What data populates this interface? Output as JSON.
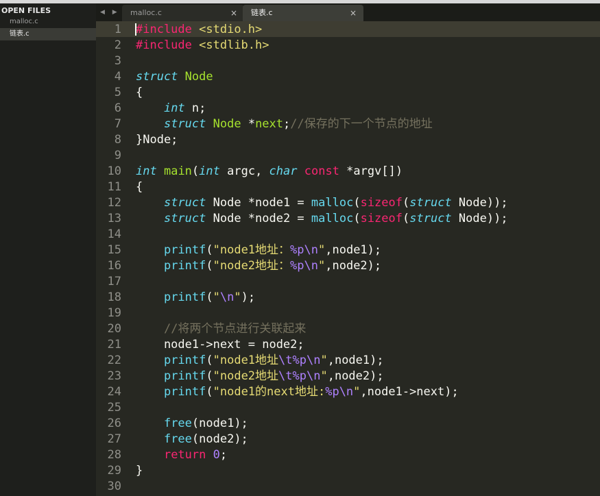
{
  "sidebar": {
    "header": "OPEN FILES",
    "items": [
      {
        "label": "malloc.c",
        "active": false
      },
      {
        "label": "链表.c",
        "active": true
      }
    ]
  },
  "tabs": {
    "nav_arrows": "◀ ▶",
    "items": [
      {
        "label": "malloc.c",
        "close": "×",
        "active": false
      },
      {
        "label": "链表.c",
        "close": "×",
        "active": true
      }
    ]
  },
  "editor": {
    "line_numbers": [
      "1",
      "2",
      "3",
      "4",
      "5",
      "6",
      "7",
      "8",
      "9",
      "10",
      "11",
      "12",
      "13",
      "14",
      "15",
      "16",
      "17",
      "18",
      "19",
      "20",
      "21",
      "22",
      "23",
      "24",
      "25",
      "26",
      "27",
      "28",
      "29",
      "30"
    ],
    "lines": [
      [
        [
          "pre",
          "#include"
        ],
        [
          "",
          " "
        ],
        [
          "str",
          "<stdio.h>"
        ]
      ],
      [
        [
          "pre",
          "#include"
        ],
        [
          "",
          " "
        ],
        [
          "str",
          "<stdlib.h>"
        ]
      ],
      [],
      [
        [
          "type",
          "struct"
        ],
        [
          "",
          " "
        ],
        [
          "cls",
          "Node"
        ]
      ],
      [
        [
          "",
          "{"
        ]
      ],
      [
        [
          "",
          "    "
        ],
        [
          "type",
          "int"
        ],
        [
          "",
          " n;"
        ]
      ],
      [
        [
          "",
          "    "
        ],
        [
          "type",
          "struct"
        ],
        [
          "",
          " "
        ],
        [
          "cls",
          "Node"
        ],
        [
          "",
          " *"
        ],
        [
          "cls",
          "next"
        ],
        [
          "",
          ";"
        ],
        [
          "cmt",
          "//保存的下一个节点的地址"
        ]
      ],
      [
        [
          "",
          "}Node;"
        ]
      ],
      [],
      [
        [
          "type",
          "int"
        ],
        [
          "",
          " "
        ],
        [
          "fn",
          "main"
        ],
        [
          "",
          "("
        ],
        [
          "type",
          "int"
        ],
        [
          "",
          " argc, "
        ],
        [
          "type",
          "char"
        ],
        [
          "",
          " "
        ],
        [
          "kw",
          "const"
        ],
        [
          "",
          " *argv[])"
        ]
      ],
      [
        [
          "",
          "{"
        ]
      ],
      [
        [
          "",
          "    "
        ],
        [
          "type",
          "struct"
        ],
        [
          "",
          " Node *node1 = "
        ],
        [
          "call",
          "malloc"
        ],
        [
          "",
          "("
        ],
        [
          "kw",
          "sizeof"
        ],
        [
          "",
          "("
        ],
        [
          "type",
          "struct"
        ],
        [
          "",
          " Node));"
        ]
      ],
      [
        [
          "",
          "    "
        ],
        [
          "type",
          "struct"
        ],
        [
          "",
          " Node *node2 = "
        ],
        [
          "call",
          "malloc"
        ],
        [
          "",
          "("
        ],
        [
          "kw",
          "sizeof"
        ],
        [
          "",
          "("
        ],
        [
          "type",
          "struct"
        ],
        [
          "",
          " Node));"
        ]
      ],
      [],
      [
        [
          "",
          "    "
        ],
        [
          "call",
          "printf"
        ],
        [
          "",
          "("
        ],
        [
          "str",
          "\"node1地址："
        ],
        [
          "esc",
          "%p\\n"
        ],
        [
          "str",
          "\""
        ],
        [
          "",
          ",node1);"
        ]
      ],
      [
        [
          "",
          "    "
        ],
        [
          "call",
          "printf"
        ],
        [
          "",
          "("
        ],
        [
          "str",
          "\"node2地址："
        ],
        [
          "esc",
          "%p\\n"
        ],
        [
          "str",
          "\""
        ],
        [
          "",
          ",node2);"
        ]
      ],
      [],
      [
        [
          "",
          "    "
        ],
        [
          "call",
          "printf"
        ],
        [
          "",
          "("
        ],
        [
          "str",
          "\""
        ],
        [
          "esc",
          "\\n"
        ],
        [
          "str",
          "\""
        ],
        [
          "",
          ");"
        ]
      ],
      [],
      [
        [
          "",
          "    "
        ],
        [
          "cmt",
          "//将两个节点进行关联起来"
        ]
      ],
      [
        [
          "",
          "    node1->next = node2;"
        ]
      ],
      [
        [
          "",
          "    "
        ],
        [
          "call",
          "printf"
        ],
        [
          "",
          "("
        ],
        [
          "str",
          "\"node1地址"
        ],
        [
          "esc",
          "\\t%p\\n"
        ],
        [
          "str",
          "\""
        ],
        [
          "",
          ",node1);"
        ]
      ],
      [
        [
          "",
          "    "
        ],
        [
          "call",
          "printf"
        ],
        [
          "",
          "("
        ],
        [
          "str",
          "\"node2地址"
        ],
        [
          "esc",
          "\\t%p\\n"
        ],
        [
          "str",
          "\""
        ],
        [
          "",
          ",node2);"
        ]
      ],
      [
        [
          "",
          "    "
        ],
        [
          "call",
          "printf"
        ],
        [
          "",
          "("
        ],
        [
          "str",
          "\"node1的next地址:"
        ],
        [
          "esc",
          "%p\\n"
        ],
        [
          "str",
          "\""
        ],
        [
          "",
          ",node1->next);"
        ]
      ],
      [],
      [
        [
          "",
          "    "
        ],
        [
          "call",
          "free"
        ],
        [
          "",
          "(node1);"
        ]
      ],
      [
        [
          "",
          "    "
        ],
        [
          "call",
          "free"
        ],
        [
          "",
          "(node2);"
        ]
      ],
      [
        [
          "",
          "    "
        ],
        [
          "kw",
          "return"
        ],
        [
          "",
          " "
        ],
        [
          "num",
          "0"
        ],
        [
          "",
          ";"
        ]
      ],
      [
        [
          "",
          "}"
        ]
      ],
      []
    ]
  },
  "colors": {
    "background": "#272822",
    "sidebar": "#1e1f1c",
    "preprocessor": "#f92672",
    "string": "#e6db74",
    "type": "#66d9ef",
    "function": "#a6e22e",
    "comment": "#75715e",
    "escape": "#ae81ff"
  }
}
